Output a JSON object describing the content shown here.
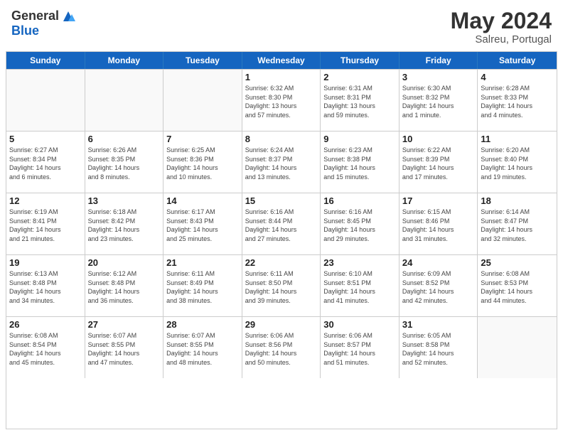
{
  "header": {
    "logo_general": "General",
    "logo_blue": "Blue",
    "month_year": "May 2024",
    "location": "Salreu, Portugal"
  },
  "weekdays": [
    "Sunday",
    "Monday",
    "Tuesday",
    "Wednesday",
    "Thursday",
    "Friday",
    "Saturday"
  ],
  "rows": [
    [
      {
        "day": "",
        "info": ""
      },
      {
        "day": "",
        "info": ""
      },
      {
        "day": "",
        "info": ""
      },
      {
        "day": "1",
        "info": "Sunrise: 6:32 AM\nSunset: 8:30 PM\nDaylight: 13 hours\nand 57 minutes."
      },
      {
        "day": "2",
        "info": "Sunrise: 6:31 AM\nSunset: 8:31 PM\nDaylight: 13 hours\nand 59 minutes."
      },
      {
        "day": "3",
        "info": "Sunrise: 6:30 AM\nSunset: 8:32 PM\nDaylight: 14 hours\nand 1 minute."
      },
      {
        "day": "4",
        "info": "Sunrise: 6:28 AM\nSunset: 8:33 PM\nDaylight: 14 hours\nand 4 minutes."
      }
    ],
    [
      {
        "day": "5",
        "info": "Sunrise: 6:27 AM\nSunset: 8:34 PM\nDaylight: 14 hours\nand 6 minutes."
      },
      {
        "day": "6",
        "info": "Sunrise: 6:26 AM\nSunset: 8:35 PM\nDaylight: 14 hours\nand 8 minutes."
      },
      {
        "day": "7",
        "info": "Sunrise: 6:25 AM\nSunset: 8:36 PM\nDaylight: 14 hours\nand 10 minutes."
      },
      {
        "day": "8",
        "info": "Sunrise: 6:24 AM\nSunset: 8:37 PM\nDaylight: 14 hours\nand 13 minutes."
      },
      {
        "day": "9",
        "info": "Sunrise: 6:23 AM\nSunset: 8:38 PM\nDaylight: 14 hours\nand 15 minutes."
      },
      {
        "day": "10",
        "info": "Sunrise: 6:22 AM\nSunset: 8:39 PM\nDaylight: 14 hours\nand 17 minutes."
      },
      {
        "day": "11",
        "info": "Sunrise: 6:20 AM\nSunset: 8:40 PM\nDaylight: 14 hours\nand 19 minutes."
      }
    ],
    [
      {
        "day": "12",
        "info": "Sunrise: 6:19 AM\nSunset: 8:41 PM\nDaylight: 14 hours\nand 21 minutes."
      },
      {
        "day": "13",
        "info": "Sunrise: 6:18 AM\nSunset: 8:42 PM\nDaylight: 14 hours\nand 23 minutes."
      },
      {
        "day": "14",
        "info": "Sunrise: 6:17 AM\nSunset: 8:43 PM\nDaylight: 14 hours\nand 25 minutes."
      },
      {
        "day": "15",
        "info": "Sunrise: 6:16 AM\nSunset: 8:44 PM\nDaylight: 14 hours\nand 27 minutes."
      },
      {
        "day": "16",
        "info": "Sunrise: 6:16 AM\nSunset: 8:45 PM\nDaylight: 14 hours\nand 29 minutes."
      },
      {
        "day": "17",
        "info": "Sunrise: 6:15 AM\nSunset: 8:46 PM\nDaylight: 14 hours\nand 31 minutes."
      },
      {
        "day": "18",
        "info": "Sunrise: 6:14 AM\nSunset: 8:47 PM\nDaylight: 14 hours\nand 32 minutes."
      }
    ],
    [
      {
        "day": "19",
        "info": "Sunrise: 6:13 AM\nSunset: 8:48 PM\nDaylight: 14 hours\nand 34 minutes."
      },
      {
        "day": "20",
        "info": "Sunrise: 6:12 AM\nSunset: 8:48 PM\nDaylight: 14 hours\nand 36 minutes."
      },
      {
        "day": "21",
        "info": "Sunrise: 6:11 AM\nSunset: 8:49 PM\nDaylight: 14 hours\nand 38 minutes."
      },
      {
        "day": "22",
        "info": "Sunrise: 6:11 AM\nSunset: 8:50 PM\nDaylight: 14 hours\nand 39 minutes."
      },
      {
        "day": "23",
        "info": "Sunrise: 6:10 AM\nSunset: 8:51 PM\nDaylight: 14 hours\nand 41 minutes."
      },
      {
        "day": "24",
        "info": "Sunrise: 6:09 AM\nSunset: 8:52 PM\nDaylight: 14 hours\nand 42 minutes."
      },
      {
        "day": "25",
        "info": "Sunrise: 6:08 AM\nSunset: 8:53 PM\nDaylight: 14 hours\nand 44 minutes."
      }
    ],
    [
      {
        "day": "26",
        "info": "Sunrise: 6:08 AM\nSunset: 8:54 PM\nDaylight: 14 hours\nand 45 minutes."
      },
      {
        "day": "27",
        "info": "Sunrise: 6:07 AM\nSunset: 8:55 PM\nDaylight: 14 hours\nand 47 minutes."
      },
      {
        "day": "28",
        "info": "Sunrise: 6:07 AM\nSunset: 8:55 PM\nDaylight: 14 hours\nand 48 minutes."
      },
      {
        "day": "29",
        "info": "Sunrise: 6:06 AM\nSunset: 8:56 PM\nDaylight: 14 hours\nand 50 minutes."
      },
      {
        "day": "30",
        "info": "Sunrise: 6:06 AM\nSunset: 8:57 PM\nDaylight: 14 hours\nand 51 minutes."
      },
      {
        "day": "31",
        "info": "Sunrise: 6:05 AM\nSunset: 8:58 PM\nDaylight: 14 hours\nand 52 minutes."
      },
      {
        "day": "",
        "info": ""
      }
    ]
  ]
}
